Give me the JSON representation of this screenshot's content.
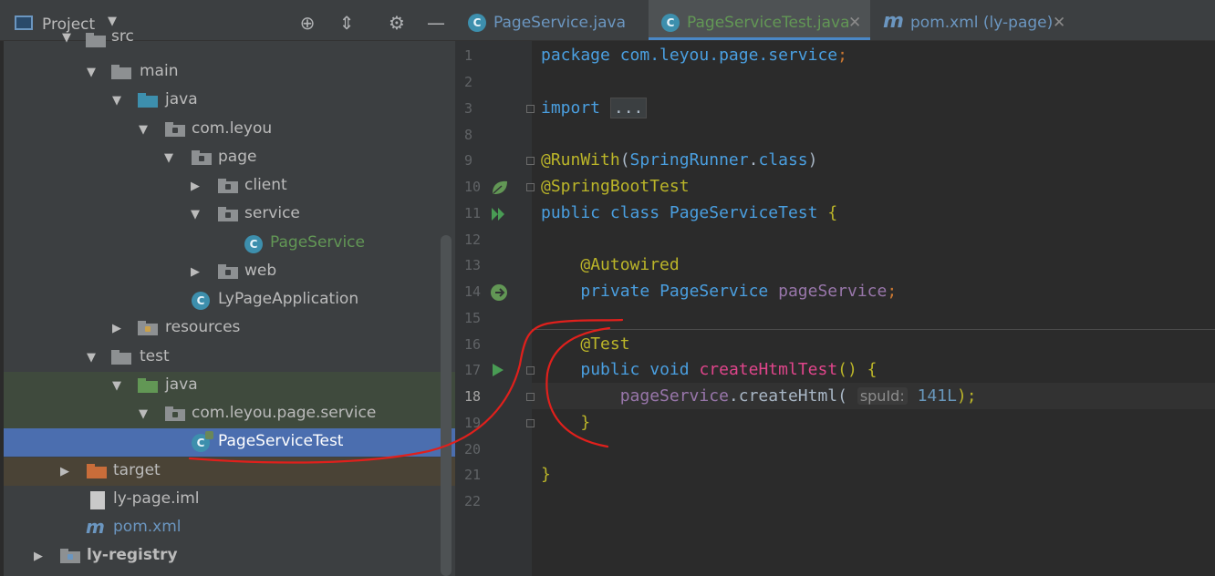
{
  "project_panel": {
    "title": "Project",
    "tree": [
      {
        "label": "src"
      },
      {
        "label": "main"
      },
      {
        "label": "java"
      },
      {
        "label": "com.leyou"
      },
      {
        "label": "page"
      },
      {
        "label": "client"
      },
      {
        "label": "service"
      },
      {
        "label": "PageService"
      },
      {
        "label": "web"
      },
      {
        "label": "LyPageApplication"
      },
      {
        "label": "resources"
      },
      {
        "label": "test"
      },
      {
        "label": "java"
      },
      {
        "label": "com.leyou.page.service"
      },
      {
        "label": "PageServiceTest"
      },
      {
        "label": "target"
      },
      {
        "label": "ly-page.iml"
      },
      {
        "label": "pom.xml"
      },
      {
        "label": "ly-registry"
      }
    ]
  },
  "editor": {
    "tabs": [
      {
        "label": "PageService.java",
        "icon": "class-icon"
      },
      {
        "label": "PageServiceTest.java",
        "icon": "test-class-icon"
      },
      {
        "label": "pom.xml (ly-page)",
        "icon": "maven-icon"
      }
    ],
    "lines": [
      {
        "num": "1"
      },
      {
        "num": "2"
      },
      {
        "num": "3"
      },
      {
        "num": "8"
      },
      {
        "num": "9"
      },
      {
        "num": "10"
      },
      {
        "num": "11"
      },
      {
        "num": "12"
      },
      {
        "num": "13"
      },
      {
        "num": "14"
      },
      {
        "num": "15"
      },
      {
        "num": "16"
      },
      {
        "num": "17"
      },
      {
        "num": "18"
      },
      {
        "num": "19"
      },
      {
        "num": "20"
      },
      {
        "num": "21"
      },
      {
        "num": "22"
      }
    ],
    "code": {
      "l1_kw": "package",
      "l1_pkg": "com.leyou.page.service",
      "l1_end": ";",
      "l3_kw": "import",
      "l3_fold": "...",
      "l9_ann": "@RunWith",
      "l9_open": "(",
      "l9_cls": "SpringRunner",
      "l9_dot": ".",
      "l9_kw": "class",
      "l9_close": ")",
      "l10_ann": "@SpringBootTest",
      "l11_kw1": "public",
      "l11_kw2": "class",
      "l11_cls": "PageServiceTest",
      "l11_brace": "{",
      "l13_ann": "@Autowired",
      "l14_kw": "private",
      "l14_type": "PageService",
      "l14_field": "pageService",
      "l14_end": ";",
      "l16_ann": "@Test",
      "l17_kw1": "public",
      "l17_kw2": "void",
      "l17_fn": "createHtmlTest",
      "l17_rest": "() {",
      "l18_field": "pageService",
      "l18_call": ".createHtml(",
      "l18_hint": "spuId:",
      "l18_num": "141L",
      "l18_end": ");",
      "l19_brace": "}",
      "l21_brace": "}"
    }
  },
  "colors": {
    "keyword": "#cc7832",
    "annotation": "#bbb529",
    "type": "#6897bb",
    "field": "#9876aa",
    "method": "#e0458b",
    "selection": "#4b6eaf"
  }
}
